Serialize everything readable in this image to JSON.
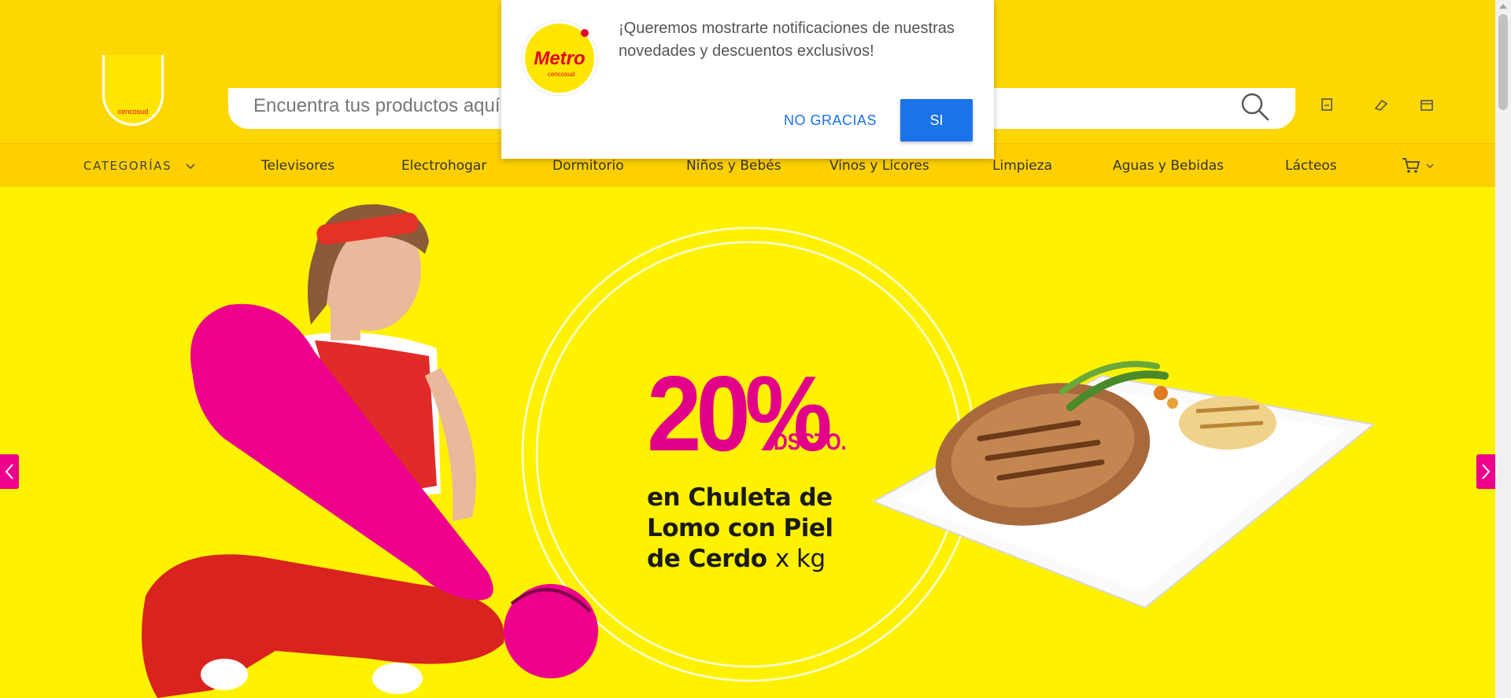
{
  "header": {
    "logo_subtext": "cencosud",
    "search": {
      "placeholder": "Encuentra tus productos aquí"
    }
  },
  "nav": {
    "categories_label": "CATEGORÍAS",
    "items": [
      {
        "label": "Televisores"
      },
      {
        "label": "Electrohogar"
      },
      {
        "label": "Dormitorio"
      },
      {
        "label": "Niños y Bebés"
      },
      {
        "label": "Vinos y Licores"
      },
      {
        "label": "Limpieza"
      },
      {
        "label": "Aguas y Bebidas"
      },
      {
        "label": "Lácteos"
      }
    ]
  },
  "hero": {
    "promo": {
      "percent": "20%",
      "suffix": "DSCTO.",
      "line1": "en Chuleta de",
      "line2": "Lomo con Piel",
      "line3": "de Cerdo",
      "unit": "x kg"
    }
  },
  "notification": {
    "brand": "Metro",
    "brand_sub": "cencosud",
    "message": "¡Queremos mostrarte notificaciones de nuestras novedades y descuentos exclusivos!",
    "decline_label": "NO GRACIAS",
    "accept_label": "SI"
  },
  "colors": {
    "brand_yellow": "#ffd700",
    "hero_yellow": "#fff200",
    "brand_magenta": "#e2008a",
    "brand_red": "#e4002b",
    "accept_blue": "#1a73e8"
  }
}
